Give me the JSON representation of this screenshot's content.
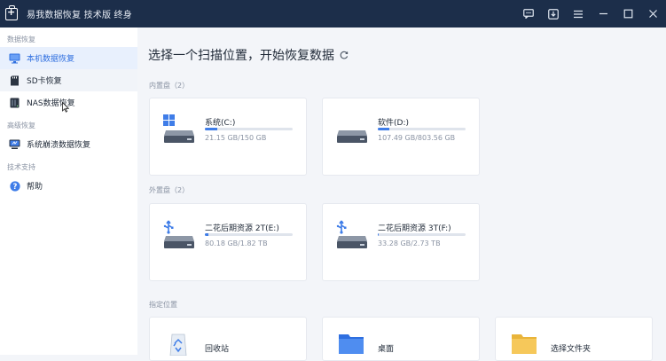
{
  "app": {
    "title": "易我数据恢复 技术版 终身"
  },
  "sidebar": {
    "sections": [
      {
        "title": "数据恢复",
        "items": [
          {
            "label": "本机数据恢复",
            "icon": "monitor-icon",
            "state": "active"
          },
          {
            "label": "SD卡恢复",
            "icon": "sd-card-icon",
            "state": "hover"
          },
          {
            "label": "NAS数据恢复",
            "icon": "nas-icon",
            "state": "normal"
          }
        ]
      },
      {
        "title": "高级恢复",
        "items": [
          {
            "label": "系统崩溃数据恢复",
            "icon": "system-crash-icon",
            "state": "normal"
          }
        ]
      },
      {
        "title": "技术支持",
        "items": [
          {
            "label": "帮助",
            "icon": "help-icon",
            "state": "normal"
          }
        ]
      }
    ]
  },
  "main": {
    "heading": "选择一个扫描位置，开始恢复数据",
    "internal": {
      "label": "内置盘（2）",
      "drives": [
        {
          "name": "系统(C:)",
          "size": "21.15 GB/150 GB",
          "used_fraction": 0.141,
          "icon": "windows-drive-icon"
        },
        {
          "name": "软件(D:)",
          "size": "107.49 GB/803.56 GB",
          "used_fraction": 0.134,
          "icon": "hard-drive-icon"
        }
      ]
    },
    "external": {
      "label": "外置盘（2）",
      "drives": [
        {
          "name": "二花后期资源 2T(E:)",
          "size": "80.18 GB/1.82 TB",
          "used_fraction": 0.043,
          "icon": "usb-drive-icon"
        },
        {
          "name": "二花后期资源 3T(F:)",
          "size": "33.28 GB/2.73 TB",
          "used_fraction": 0.012,
          "icon": "usb-drive-icon"
        }
      ]
    },
    "locations": {
      "label": "指定位置",
      "items": [
        {
          "name": "回收站",
          "icon": "recycle-bin-icon"
        },
        {
          "name": "桌面",
          "icon": "desktop-folder-icon"
        },
        {
          "name": "选择文件夹",
          "icon": "folder-icon"
        }
      ]
    }
  },
  "colors": {
    "titlebar": "#1c2e4a",
    "accent": "#3f7de8",
    "active_bg": "#e8f0fd"
  }
}
